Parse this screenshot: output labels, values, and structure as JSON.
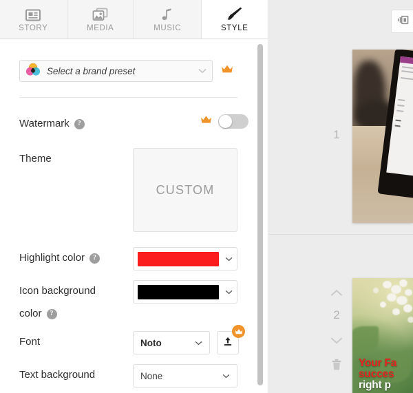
{
  "tabs": [
    {
      "label": "STORY",
      "icon": "article-icon",
      "active": false
    },
    {
      "label": "MEDIA",
      "icon": "images-icon",
      "active": false
    },
    {
      "label": "MUSIC",
      "icon": "music-note-icon",
      "active": false
    },
    {
      "label": "STYLE",
      "icon": "paintbrush-icon",
      "active": true
    }
  ],
  "brand_preset": {
    "placeholder": "Select a brand preset",
    "icon": "brand-colors-icon",
    "premium_icon": "crown-icon"
  },
  "watermark": {
    "label": "Watermark",
    "help": "?",
    "premium_icon": "crown-icon",
    "enabled": false
  },
  "theme": {
    "label": "Theme",
    "value": "CUSTOM"
  },
  "highlight_color": {
    "label": "Highlight color",
    "help": "?",
    "value": "#FB1C1C"
  },
  "icon_background_color": {
    "label_line1": "Icon background",
    "label_line2": "color",
    "help": "?",
    "value": "#000000"
  },
  "font": {
    "label": "Font",
    "value": "Noto",
    "upload_icon": "upload-icon",
    "premium_icon": "crown-icon"
  },
  "text_background": {
    "label": "Text background",
    "value": "None"
  },
  "preview": {
    "layout_toggle_icon": "panel-layout-icon",
    "scenes": [
      {
        "number": "1",
        "kind": "photo-tablet-desk"
      },
      {
        "number": "2",
        "kind": "photo-flowers-text",
        "text_lines": [
          "Your Fa",
          "succes",
          "right p"
        ]
      }
    ],
    "nav": {
      "up_icon": "chevron-up-icon",
      "down_icon": "chevron-down-icon",
      "delete_icon": "trash-icon"
    }
  },
  "colors": {
    "accent_premium": "#F0932B",
    "highlight": "#FB1C1C",
    "icon_bg": "#000000",
    "panel_bg": "#FFFFFF",
    "app_bg": "#ECECEC",
    "text_red": "#E8231E"
  }
}
